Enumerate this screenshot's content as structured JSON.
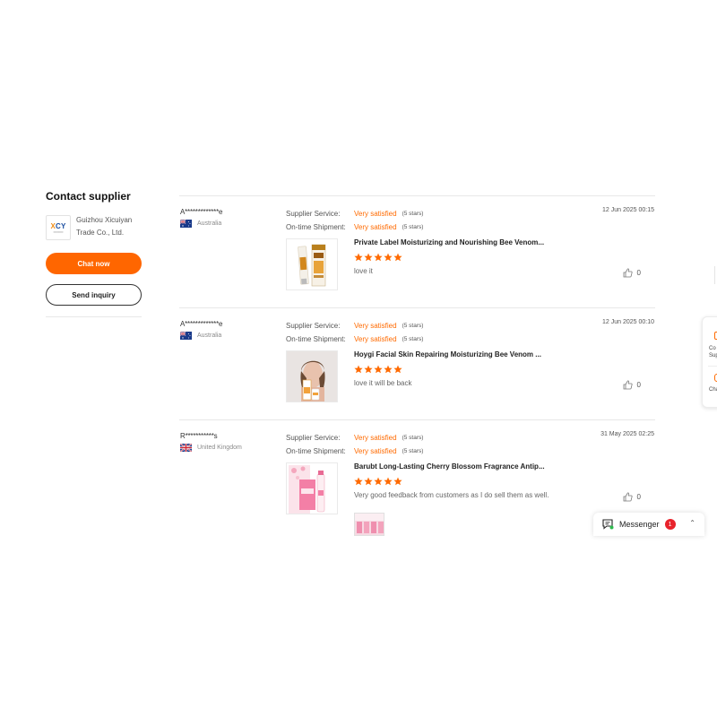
{
  "contact": {
    "title": "Contact supplier",
    "logo_text_1": "X",
    "logo_text_2": "CY",
    "supplier_line1": "Guizhou Xicuiyan",
    "supplier_line2": "Trade Co., Ltd.",
    "chat_label": "Chat now",
    "inquiry_label": "Send inquiry"
  },
  "labels": {
    "supplier_service": "Supplier Service:",
    "ontime_shipment": "On-time Shipment:"
  },
  "reviews": [
    {
      "name": "A*************e",
      "country": "Australia",
      "supplier_value": "Very satisfied",
      "supplier_stars": "(5 stars)",
      "shipment_value": "Very satisfied",
      "shipment_stars": "(5 stars)",
      "date": "12 Jun 2025 00:15",
      "product_title": "Private Label Moisturizing and Nourishing Bee Venom...",
      "rating": 5,
      "comment": "love it",
      "likes": "0"
    },
    {
      "name": "A*************e",
      "country": "Australia",
      "supplier_value": "Very satisfied",
      "supplier_stars": "(5 stars)",
      "shipment_value": "Very satisfied",
      "shipment_stars": "(5 stars)",
      "date": "12 Jun 2025 00:10",
      "product_title": "Hoygi Facial Skin Repairing Moisturizing Bee Venom ...",
      "rating": 5,
      "comment": "love it will be back",
      "likes": "0"
    },
    {
      "name": "R***********s",
      "country": "United Kingdom",
      "supplier_value": "Very satisfied",
      "supplier_stars": "(5 stars)",
      "shipment_value": "Very satisfied",
      "shipment_stars": "(5 stars)",
      "date": "31 May 2025 02:25",
      "product_title": "Barubt Long-Lasting Cherry Blossom Fragrance Antip...",
      "rating": 5,
      "comment": "Very good feedback from customers as I do sell them as well.",
      "likes": "0"
    }
  ],
  "side_panel": {
    "item1_line1": "Co",
    "item1_line2": "Sup",
    "item2_line1": "Cha"
  },
  "messenger": {
    "label": "Messenger",
    "badge": "1"
  },
  "colors": {
    "accent": "#ff6600",
    "satisfied": "#ff6a00",
    "badge": "#e8232c"
  },
  "icons": [
    "thumbs-up-icon",
    "star-icon",
    "flag-australia-icon",
    "flag-uk-icon",
    "messenger-icon",
    "chevron-up-icon"
  ]
}
